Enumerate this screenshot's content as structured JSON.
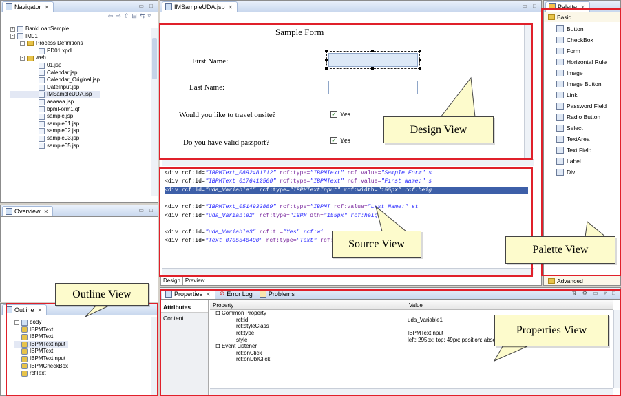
{
  "navigator": {
    "tab": "Navigator",
    "items": [
      {
        "label": "BankLoanSample",
        "depth": 0,
        "kind": "project",
        "exp": "+"
      },
      {
        "label": "IM01",
        "depth": 0,
        "kind": "project",
        "exp": "-"
      },
      {
        "label": "Process Definitions",
        "depth": 1,
        "kind": "folder",
        "exp": "-"
      },
      {
        "label": "PD01.xpdl",
        "depth": 2,
        "kind": "file",
        "exp": ""
      },
      {
        "label": "web",
        "depth": 1,
        "kind": "folder",
        "exp": "-"
      },
      {
        "label": "01.jsp",
        "depth": 2,
        "kind": "file",
        "exp": ""
      },
      {
        "label": "Calendar.jsp",
        "depth": 2,
        "kind": "file",
        "exp": ""
      },
      {
        "label": "Calendar_Original.jsp",
        "depth": 2,
        "kind": "file",
        "exp": ""
      },
      {
        "label": "DateInput.jsp",
        "depth": 2,
        "kind": "file",
        "exp": ""
      },
      {
        "label": "IMSampleUDA.jsp",
        "depth": 2,
        "kind": "file",
        "exp": "",
        "selected": true
      },
      {
        "label": "aaaaaa.jsp",
        "depth": 2,
        "kind": "file",
        "exp": ""
      },
      {
        "label": "bpmForm1.qf",
        "depth": 2,
        "kind": "file",
        "exp": ""
      },
      {
        "label": "sample.jsp",
        "depth": 2,
        "kind": "file",
        "exp": ""
      },
      {
        "label": "sample01.jsp",
        "depth": 2,
        "kind": "file",
        "exp": ""
      },
      {
        "label": "sample02.jsp",
        "depth": 2,
        "kind": "file",
        "exp": ""
      },
      {
        "label": "sample03.jsp",
        "depth": 2,
        "kind": "file",
        "exp": ""
      },
      {
        "label": "sample05.jsp",
        "depth": 2,
        "kind": "file",
        "exp": ""
      }
    ]
  },
  "overview": {
    "tab": "Overview"
  },
  "outline": {
    "tab": "Outline",
    "items": [
      {
        "label": "body",
        "depth": 0,
        "exp": "-"
      },
      {
        "label": "IBPMText",
        "depth": 1
      },
      {
        "label": "IBPMText",
        "depth": 1
      },
      {
        "label": "IBPMTextInput",
        "depth": 1,
        "selected": true
      },
      {
        "label": "IBPMText",
        "depth": 1
      },
      {
        "label": "IBPMTextInput",
        "depth": 1
      },
      {
        "label": "IBPMCheckBox",
        "depth": 1
      },
      {
        "label": "rcfText",
        "depth": 1
      }
    ]
  },
  "editor": {
    "tab": "IMSampleUDA.jsp",
    "form_title": "Sample Form",
    "first_name": "First Name:",
    "last_name": "Last Name:",
    "travel_q": "Would you like to travel onsite?",
    "passport_q": "Do you have valid passport?",
    "yes": "Yes",
    "source_lines": [
      {
        "pre": "<div rcf:id=",
        "id": "\"IBPMText_0892481712\"",
        "t": " rcf:type=",
        "tv": "\"IBPMText\"",
        "r": " rcf:value=",
        "rv": "\"Sample Form\" s"
      },
      {
        "pre": "<div rcf:id=",
        "id": "\"IBPMText_0176412560\"",
        "t": " rcf:type=",
        "tv": "\"IBPMText\"",
        "r": " rcf:value=",
        "rv": "\"First Name:\" s"
      },
      {
        "pre": "<div rcf:id=",
        "id": "\"uda_Variable1\"",
        "t": " rcf:type=",
        "tv": "\"IBPMTextInput\"",
        "r": " rcf:width=",
        "rv": "\"155px\" rcf:heig",
        "selected": true
      },
      {
        "pre": "",
        "id": "",
        "t": "",
        "tv": "",
        "r": "",
        "rv": ""
      },
      {
        "pre": "<div rcf:id=",
        "id": "\"IBPMText_0514933889\"",
        "t": " rcf:type=",
        "tv": "\"IBPMT",
        "r": "      rcf:value=",
        "rv": "\"Last Name:\" st"
      },
      {
        "pre": "<div rcf:id=",
        "id": "\"uda_Variable2\"",
        "t": " rcf:type=",
        "tv": "\"IBPM",
        "r": "            dth=",
        "rv": "\"155px\" rcf:heig"
      },
      {
        "pre": "",
        "id": "",
        "t": "",
        "tv": "",
        "r": "",
        "rv": ""
      },
      {
        "pre": "<div rcf:id=",
        "id": "\"uda_Variable3\"",
        "t": " rcf:t",
        "tv": "",
        "r": "                      =",
        "rv": "\"Yes\" rcf:wi"
      },
      {
        "pre": "<div rcf:id=",
        "id": "\"Text_0705546490\"",
        "t": " rcf:type=",
        "tv": "\"Text\"",
        "r": " rcf:value=",
        "rv": "\"Would you like to"
      }
    ],
    "bottom_tabs": [
      "Design",
      "Preview"
    ]
  },
  "palette": {
    "tab": "Palette",
    "drawer": "Basic",
    "items": [
      "Button",
      "CheckBox",
      "Form",
      "Horizontal Rule",
      "Image",
      "Image Button",
      "Link",
      "Password Field",
      "Radio Button",
      "Select",
      "TextArea",
      "Text Field",
      "Label",
      "Div"
    ],
    "advanced": "Advanced"
  },
  "properties": {
    "tabs": [
      "Properties",
      "Error Log",
      "Problems"
    ],
    "side_tabs": [
      "Attributes",
      "Content"
    ],
    "col_property": "Property",
    "col_value": "Value",
    "rows": [
      {
        "p": "Common Property",
        "v": "",
        "group": true
      },
      {
        "p": "rcf:id",
        "v": "uda_Variable1"
      },
      {
        "p": "rcf:styleClass",
        "v": ""
      },
      {
        "p": "rcf:type",
        "v": "IBPMTextInput"
      },
      {
        "p": "style",
        "v": "left: 295px; top: 49px; position: absolute"
      },
      {
        "p": "Event Listener",
        "v": "",
        "group": true
      },
      {
        "p": "rcf:onClick",
        "v": ""
      },
      {
        "p": "rcf:onDblClick",
        "v": ""
      }
    ]
  },
  "callouts": {
    "design": "Design View",
    "source": "Source View",
    "palette": "Palette View",
    "outline": "Outline View",
    "properties": "Properties View"
  }
}
